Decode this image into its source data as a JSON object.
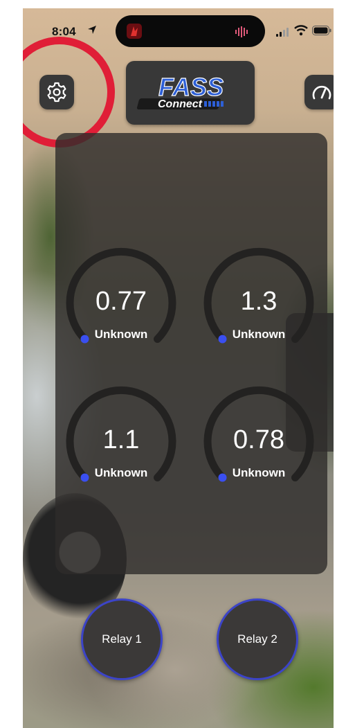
{
  "status_bar": {
    "time": "8:04",
    "icons": [
      "location-arrow-icon",
      "app-icon",
      "waveform-icon",
      "signal-icon",
      "wifi-icon",
      "battery-icon"
    ]
  },
  "header": {
    "settings_icon": "gear-icon",
    "logo_text_top": "FASS",
    "logo_text_bottom": "Connect",
    "gauge_icon": "speedometer-icon"
  },
  "gauges": [
    {
      "value": "0.77",
      "label": "Unknown"
    },
    {
      "value": "1.3",
      "label": "Unknown"
    },
    {
      "value": "1.1",
      "label": "Unknown"
    },
    {
      "value": "0.78",
      "label": "Unknown"
    }
  ],
  "relays": [
    {
      "label": "Relay 1"
    },
    {
      "label": "Relay 2"
    }
  ],
  "colors": {
    "accent_blue": "#3a4ff0",
    "highlight_red": "#e01e37",
    "panel": "#2e2c2a",
    "button": "#383838"
  }
}
